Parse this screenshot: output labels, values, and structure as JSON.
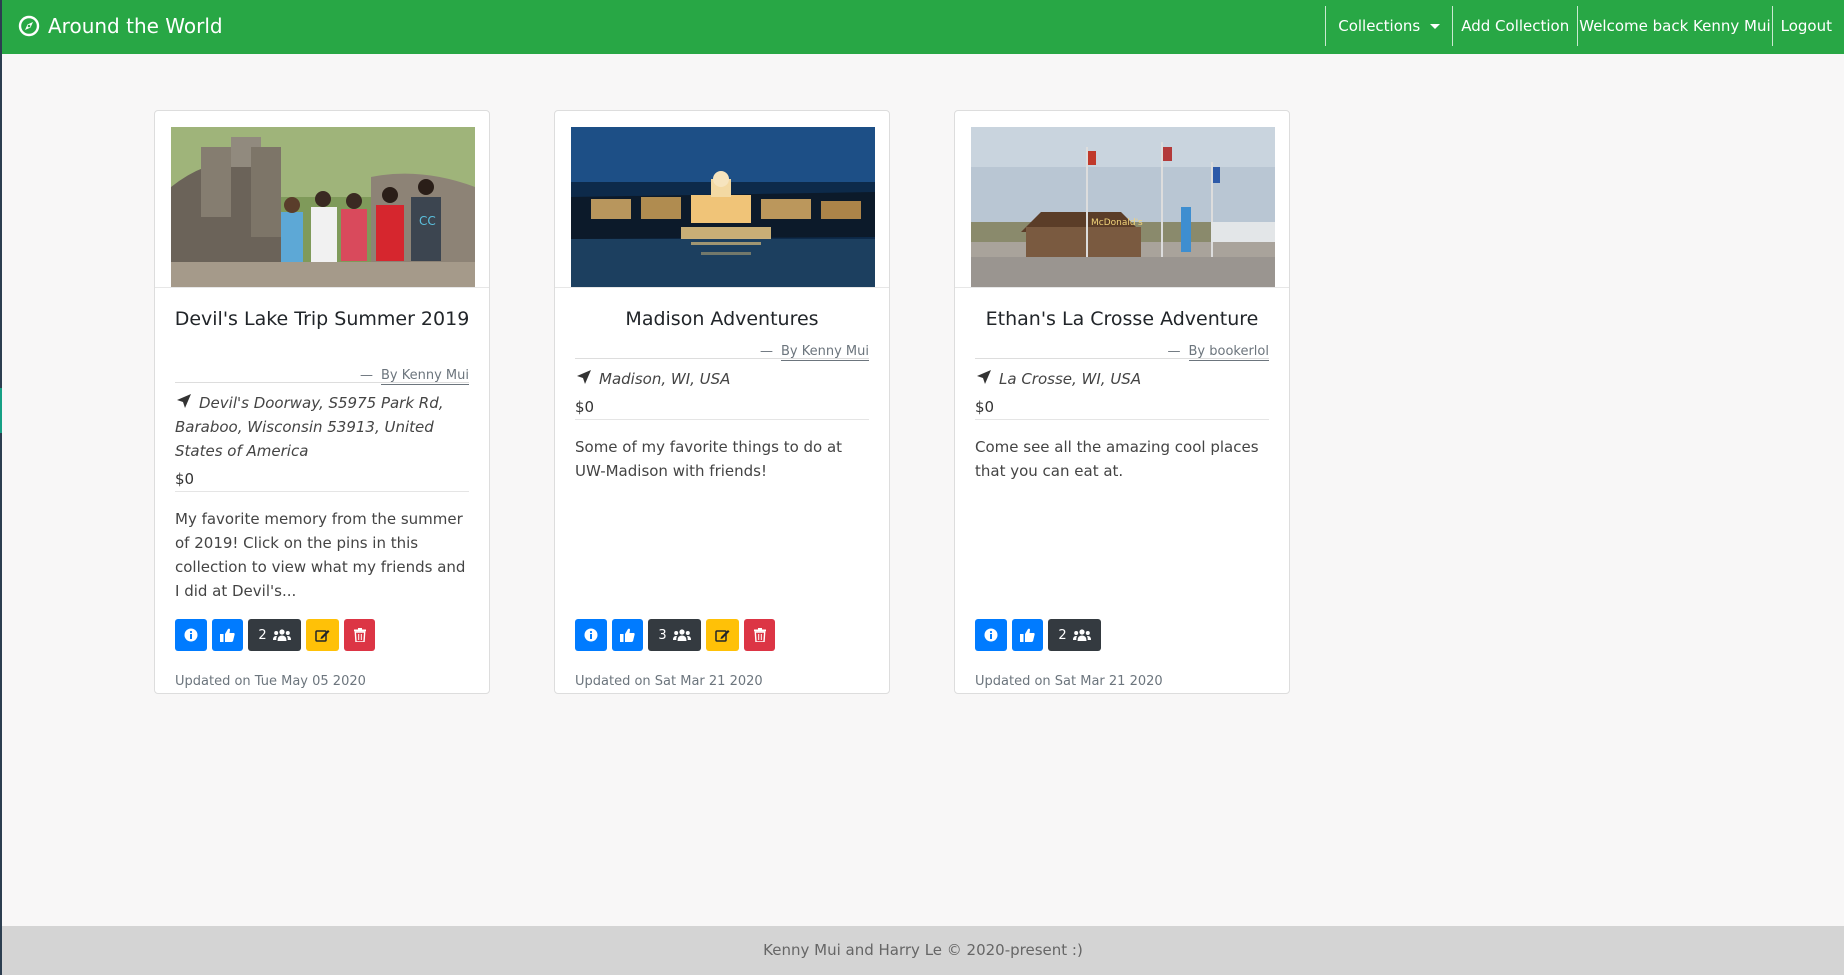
{
  "navbar": {
    "brand": "Around the World",
    "collections_label": "Collections",
    "add_collection_label": "Add Collection",
    "welcome_text": "Welcome back Kenny Mui",
    "logout_label": "Logout"
  },
  "cards": [
    {
      "title": "Devil's Lake Trip Summer 2019",
      "author": "By Kenny Mui",
      "location": "Devil's Doorway, S5975 Park Rd, Baraboo, Wisconsin 53913, United States of America",
      "price": "$0",
      "description": "My favorite memory from the summer of 2019! Click on the pins in this collection to view what my friends and I did at Devil's...",
      "member_count": "2",
      "updated": "Updated on Tue May 05 2020"
    },
    {
      "title": "Madison Adventures",
      "author": "By Kenny Mui",
      "location": "Madison, WI, USA",
      "price": "$0",
      "description": "Some of my favorite things to do at UW-Madison with friends!",
      "member_count": "3",
      "updated": "Updated on Sat Mar 21 2020"
    },
    {
      "title": "Ethan's La Crosse Adventure",
      "author": "By bookerlol",
      "location": "La Crosse, WI, USA",
      "price": "$0",
      "description": "Come see all the amazing cool places that you can eat at.",
      "member_count": "2",
      "updated": "Updated on Sat Mar 21 2020"
    }
  ],
  "footer": {
    "text": "Kenny Mui and Harry Le © 2020-present :)"
  },
  "colors": {
    "navbar": "#28a745",
    "primary": "#007bff",
    "dark": "#343a40",
    "warning": "#ffc107",
    "danger": "#dc3545"
  },
  "icons": {
    "brand": "compass-icon",
    "location": "location-arrow-icon",
    "info": "info-circle-icon",
    "like": "thumbs-up-icon",
    "members": "users-icon",
    "edit": "edit-icon",
    "delete": "trash-icon"
  }
}
